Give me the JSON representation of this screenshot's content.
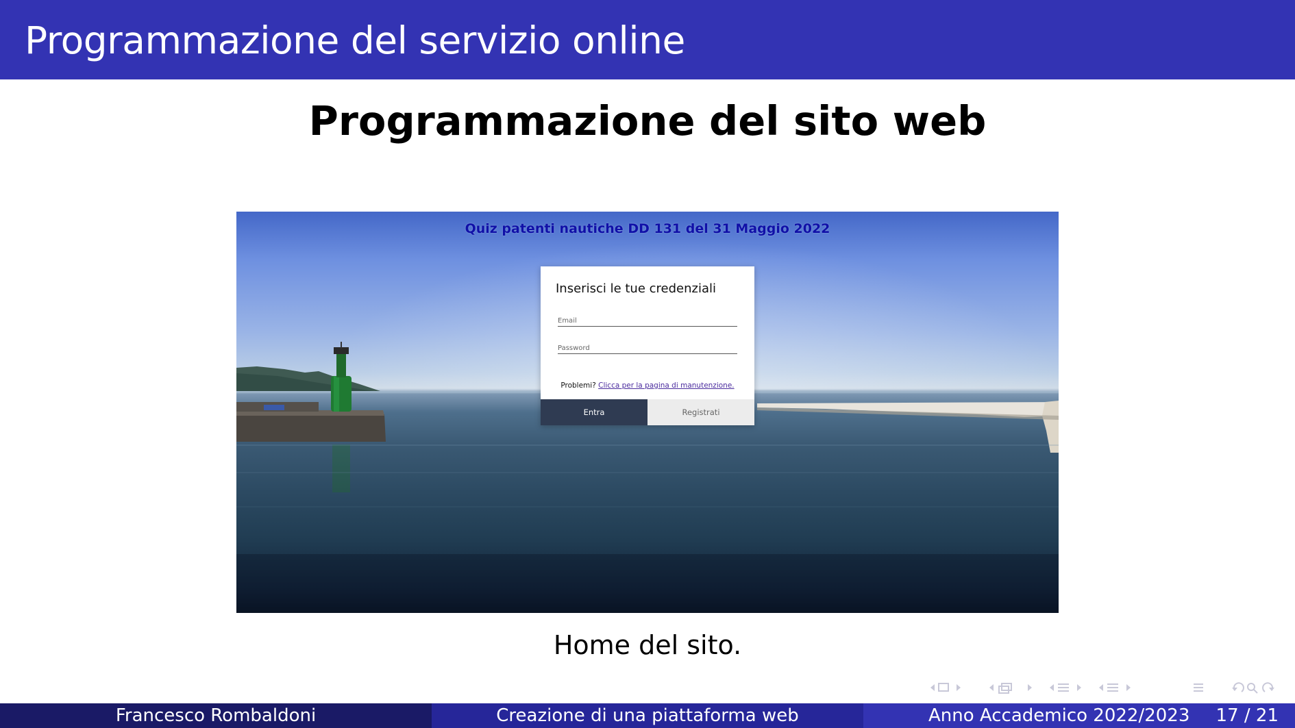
{
  "header": {
    "title": "Programmazione del servizio online"
  },
  "slide": {
    "heading": "Programmazione del sito web"
  },
  "screenshot": {
    "site_title": "Quiz patenti nautiche DD 131 del 31 Maggio 2022",
    "login": {
      "heading": "Inserisci le tue credenziali",
      "email_placeholder": "Email",
      "password_placeholder": "Password",
      "problems_text": "Problemi?",
      "maintenance_link": "Clicca per la pagina di manutenzione.",
      "enter_button": "Entra",
      "register_button": "Registrati"
    }
  },
  "caption": "Home del sito.",
  "footer": {
    "author": "Francesco Rombaldoni",
    "title": "Creazione di una piattaforma web",
    "academic_year": "Anno Accademico 2022/2023",
    "page": "17 / 21"
  },
  "colors": {
    "header_bar": "#3333b3",
    "footer_left": "#1a1a66",
    "footer_middle": "#262699",
    "footer_right": "#3333b3",
    "site_title": "#1010a8",
    "enter_button": "#2f3b52"
  },
  "icons": [
    "nav-prev-arrow",
    "frame-icon",
    "nav-next-arrow",
    "subsection-icon",
    "section-icon",
    "toc-icon",
    "undo-icon",
    "search-icon",
    "redo-icon"
  ]
}
